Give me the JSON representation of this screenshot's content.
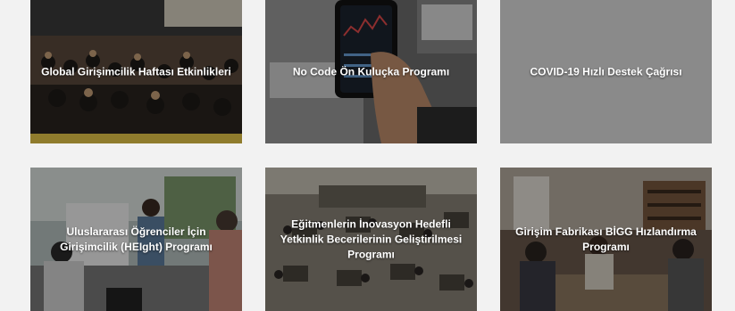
{
  "programs": [
    {
      "title": "Global Girişimcilik Haftası Etkinlikleri"
    },
    {
      "title": "No Code Ön Kuluçka Programı"
    },
    {
      "title": "COVID-19 Hızlı Destek Çağrısı"
    },
    {
      "title": "Uluslararası Öğrenciler İçin Girişimcilik (HEIght) Programı"
    },
    {
      "title": "Eğitmenlerin İnovasyon Hedefli Yetkinlik Becerilerinin Geliştirilmesi Programı"
    },
    {
      "title": "Girişim Fabrikası BİGG Hızlandırma Programı"
    }
  ],
  "colors": {
    "page_background": "#f2f2f2",
    "plain_card": "#8a8a8a",
    "caption_text": "#ffffff"
  }
}
